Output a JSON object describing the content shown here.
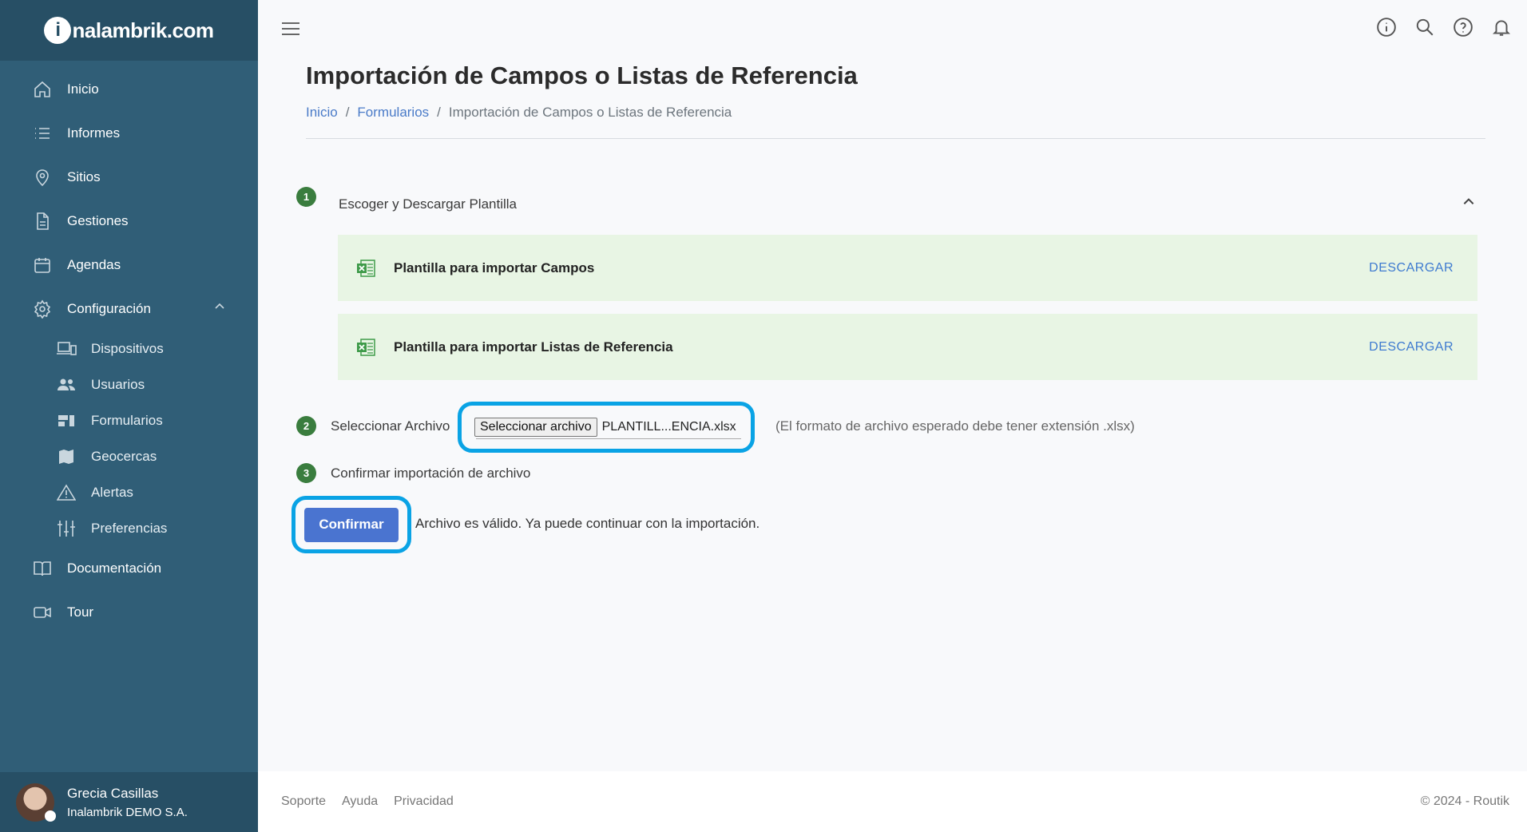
{
  "brand": {
    "logo_text": "nalambrik.com",
    "logo_initial": "i"
  },
  "sidebar": {
    "items": [
      {
        "label": "Inicio",
        "icon": "home-icon"
      },
      {
        "label": "Informes",
        "icon": "list-icon"
      },
      {
        "label": "Sitios",
        "icon": "map-pin-icon"
      },
      {
        "label": "Gestiones",
        "icon": "document-icon"
      },
      {
        "label": "Agendas",
        "icon": "calendar-icon"
      },
      {
        "label": "Configuración",
        "icon": "gear-icon",
        "expanded": true
      }
    ],
    "sub_items": [
      {
        "label": "Dispositivos",
        "icon": "devices-icon"
      },
      {
        "label": "Usuarios",
        "icon": "users-icon"
      },
      {
        "label": "Formularios",
        "icon": "forms-icon"
      },
      {
        "label": "Geocercas",
        "icon": "map-icon"
      },
      {
        "label": "Alertas",
        "icon": "warning-icon"
      },
      {
        "label": "Preferencias",
        "icon": "sliders-icon"
      }
    ],
    "bottom_items": [
      {
        "label": "Documentación",
        "icon": "book-icon"
      },
      {
        "label": "Tour",
        "icon": "video-icon"
      }
    ],
    "user": {
      "name": "Grecia Casillas",
      "org": "Inalambrik DEMO S.A."
    }
  },
  "page": {
    "title": "Importación de Campos o Listas de Referencia",
    "breadcrumb": [
      "Inicio",
      "Formularios",
      "Importación de Campos o Listas de Referencia"
    ]
  },
  "steps": {
    "step1": {
      "num": "1",
      "label": "Escoger y Descargar Plantilla"
    },
    "step2": {
      "num": "2",
      "label": "Seleccionar Archivo"
    },
    "step3": {
      "num": "3",
      "label": "Confirmar importación de archivo"
    }
  },
  "templates": [
    {
      "name": "Plantilla para importar Campos",
      "action": "DESCARGAR"
    },
    {
      "name": "Plantilla para importar Listas de Referencia",
      "action": "DESCARGAR"
    }
  ],
  "file": {
    "button_label": "Seleccionar archivo",
    "file_name": "PLANTILL...ENCIA.xlsx",
    "hint": "(El formato de archivo esperado debe tener extensión .xlsx)"
  },
  "confirm": {
    "button_label": "Confirmar",
    "message": "Archivo es válido. Ya puede continuar con la importación."
  },
  "footer": {
    "links": [
      "Soporte",
      "Ayuda",
      "Privacidad"
    ],
    "copyright": "© 2024 - Routik"
  },
  "colors": {
    "sidebar": "#305e77",
    "sidebar_dark": "#274f65",
    "step_badge": "#3a7d3e",
    "template_bg": "#e8f5e4",
    "primary": "#4a74d0",
    "highlight": "#0aa3e5"
  }
}
